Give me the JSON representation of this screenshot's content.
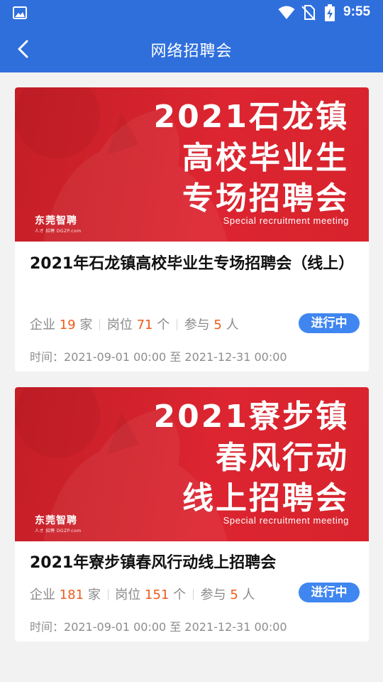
{
  "status_bar": {
    "time": "9:55",
    "icons": [
      "image-icon",
      "wifi-icon",
      "no-sim-icon",
      "battery-charging-icon"
    ]
  },
  "app_bar": {
    "title": "网络招聘会",
    "back_icon": "back-arrow-icon"
  },
  "colors": {
    "primary": "#2f6fdc",
    "banner_red": "#dc2530",
    "highlight_number": "#f05a1a",
    "badge": "#3f86f0"
  },
  "fairs": [
    {
      "banner": {
        "lines": [
          "2021石龙镇",
          "高校毕业生",
          "专场招聘会"
        ],
        "subtitle": "Special recruitment meeting",
        "logo": "东莞智聘",
        "logo_small": "人才 招聘 DGZP.com"
      },
      "title": "2021年石龙镇高校毕业生专场招聘会（线上）",
      "companies_label": "企业",
      "companies": "19",
      "companies_unit": "家",
      "positions_label": "岗位",
      "positions": "71",
      "positions_unit": "个",
      "participants_label": "参与",
      "participants": "5",
      "participants_unit": "人",
      "status": "进行中",
      "time_label": "时间：",
      "start": "2021-09-01 00:00",
      "to": "至",
      "end": "2021-12-31 00:00"
    },
    {
      "banner": {
        "lines": [
          "2021寮步镇",
          "春风行动",
          "线上招聘会"
        ],
        "subtitle": "Special recruitment meeting",
        "logo": "东莞智聘",
        "logo_small": "人才 招聘 DGZP.com"
      },
      "title": "2021年寮步镇春风行动线上招聘会",
      "companies_label": "企业",
      "companies": "181",
      "companies_unit": "家",
      "positions_label": "岗位",
      "positions": "151",
      "positions_unit": "个",
      "participants_label": "参与",
      "participants": "5",
      "participants_unit": "人",
      "status": "进行中",
      "time_label": "时间：",
      "start": "2021-09-01 00:00",
      "to": "至",
      "end": "2021-12-31 00:00"
    }
  ]
}
